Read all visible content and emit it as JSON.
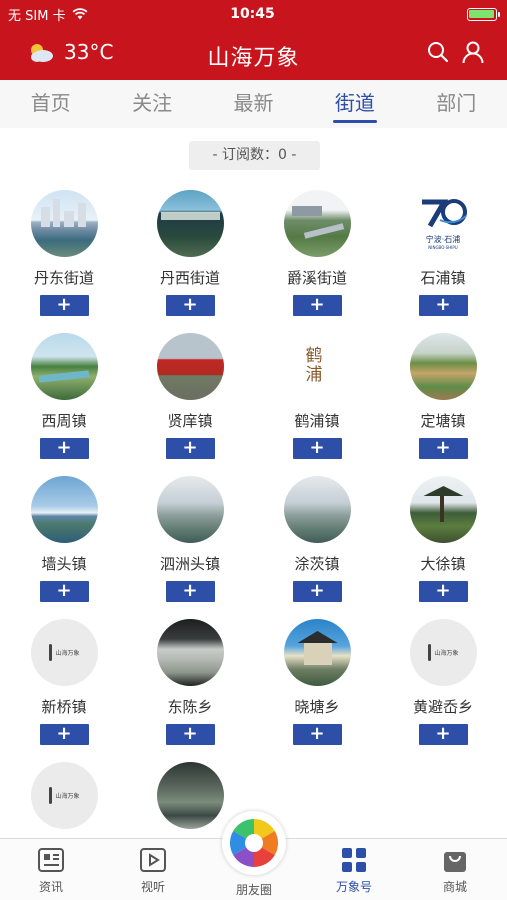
{
  "status_bar": {
    "carrier": "无 SIM 卡",
    "time": "10:45",
    "battery_level": 1.0
  },
  "header": {
    "weather_temp": "33°C",
    "title": "山海万象",
    "icons": [
      "search-icon",
      "user-icon"
    ]
  },
  "tabs": [
    {
      "label": "首页",
      "active": false
    },
    {
      "label": "关注",
      "active": false
    },
    {
      "label": "最新",
      "active": false
    },
    {
      "label": "街道",
      "active": true
    },
    {
      "label": "部门",
      "active": false
    }
  ],
  "subscription": {
    "count_text": "- 订阅数：0 -"
  },
  "channels": [
    {
      "name": "丹东街道",
      "subscribe": "+"
    },
    {
      "name": "丹西街道",
      "subscribe": "+"
    },
    {
      "name": "爵溪街道",
      "subscribe": "+"
    },
    {
      "name": "石浦镇",
      "subscribe": "+"
    },
    {
      "name": "西周镇",
      "subscribe": "+"
    },
    {
      "name": "贤庠镇",
      "subscribe": "+"
    },
    {
      "name": "鹤浦镇",
      "subscribe": "+"
    },
    {
      "name": "定塘镇",
      "subscribe": "+"
    },
    {
      "name": "墙头镇",
      "subscribe": "+"
    },
    {
      "name": "泗洲头镇",
      "subscribe": "+"
    },
    {
      "name": "涂茨镇",
      "subscribe": "+"
    },
    {
      "name": "大徐镇",
      "subscribe": "+"
    },
    {
      "name": "新桥镇",
      "subscribe": "+"
    },
    {
      "name": "东陈乡",
      "subscribe": "+"
    },
    {
      "name": "晓塘乡",
      "subscribe": "+"
    },
    {
      "name": "黄避岙乡",
      "subscribe": "+"
    },
    {
      "name": "",
      "subscribe": ""
    },
    {
      "name": "",
      "subscribe": ""
    }
  ],
  "logo_texts": {
    "shipu": "宁波·石浦",
    "shipu_sub": "NINGBO·SHIPU",
    "placeholder": "山海万象",
    "hepu": "鹤浦"
  },
  "bottom_nav": [
    {
      "label": "资讯",
      "icon": "news-icon"
    },
    {
      "label": "视听",
      "icon": "video-icon"
    },
    {
      "label": "朋友圈",
      "icon": "aperture-icon"
    },
    {
      "label": "万象号",
      "icon": "grid-icon",
      "active": true
    },
    {
      "label": "商城",
      "icon": "shopping-bag-icon"
    }
  ],
  "colors": {
    "brand_red": "#c8151d",
    "accent_blue": "#2d4fa8"
  }
}
